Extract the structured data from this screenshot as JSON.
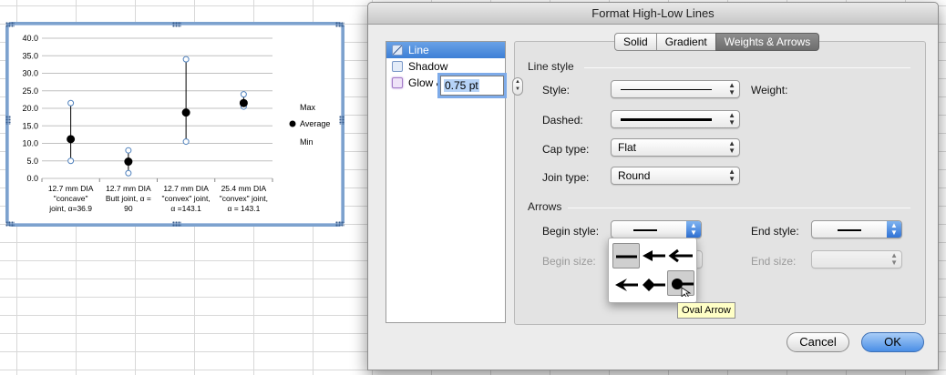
{
  "dialog": {
    "title": "Format High-Low Lines",
    "categories": [
      {
        "label": "Line",
        "icon": "line-style-icon",
        "selected": true
      },
      {
        "label": "Shadow",
        "icon": "shadow-icon",
        "selected": false
      },
      {
        "label": "Glow & Soft Edges",
        "icon": "glow-icon",
        "selected": false
      }
    ],
    "tabs": [
      {
        "label": "Solid",
        "active": false
      },
      {
        "label": "Gradient",
        "active": false
      },
      {
        "label": "Weights & Arrows",
        "active": true
      }
    ],
    "line_style": {
      "section_title": "Line style",
      "style_label": "Style:",
      "weight_label": "Weight:",
      "weight_value": "0.75 pt",
      "dashed_label": "Dashed:",
      "cap_type_label": "Cap type:",
      "cap_type_value": "Flat",
      "join_type_label": "Join type:",
      "join_type_value": "Round"
    },
    "arrows": {
      "section_title": "Arrows",
      "begin_style_label": "Begin style:",
      "end_style_label": "End style:",
      "begin_size_label": "Begin size:",
      "end_size_label": "End size:",
      "tooltip": "Oval Arrow",
      "palette_icons": [
        "no-arrow-icon",
        "triangle-arrow-icon",
        "open-arrow-icon",
        "stealth-arrow-icon",
        "diamond-arrow-icon",
        "oval-arrow-icon"
      ]
    },
    "buttons": {
      "cancel": "Cancel",
      "ok": "OK"
    }
  },
  "chart_data": {
    "type": "scatter",
    "categories": [
      "12.7 mm DIA \"concave\" joint, α=36.9",
      "12.7 mm DIA Butt joint, α = 90",
      "12.7 mm DIA \"convex\" joint, α =143.1",
      "25.4 mm DIA \"convex\" joint, α = 143.1"
    ],
    "category_lines": [
      [
        "12.7 mm DIA",
        "\"concave\"",
        "joint, α=36.9"
      ],
      [
        "12.7 mm DIA",
        "Butt joint, α =",
        "90"
      ],
      [
        "12.7 mm DIA",
        "\"convex\" joint,",
        "α =143.1"
      ],
      [
        "25.4 mm DIA",
        "\"convex\" joint,",
        "α = 143.1"
      ]
    ],
    "series": [
      {
        "name": "Max",
        "values": [
          21.5,
          8.0,
          34.0,
          24.0
        ]
      },
      {
        "name": "Average",
        "values": [
          11.2,
          4.8,
          18.8,
          21.5
        ]
      },
      {
        "name": "Min",
        "values": [
          5.0,
          1.5,
          10.5,
          20.5
        ]
      }
    ],
    "ylim": [
      0,
      40
    ],
    "yticks": [
      "0.0",
      "5.0",
      "10.0",
      "15.0",
      "20.0",
      "25.0",
      "30.0",
      "35.0",
      "40.0"
    ],
    "grid": true,
    "legend_position": "right",
    "high_low_lines": true,
    "colors": {
      "max": "#4f81bd",
      "average": "#000000",
      "min": "#4f81bd",
      "grid": "#c0c0c0"
    }
  }
}
